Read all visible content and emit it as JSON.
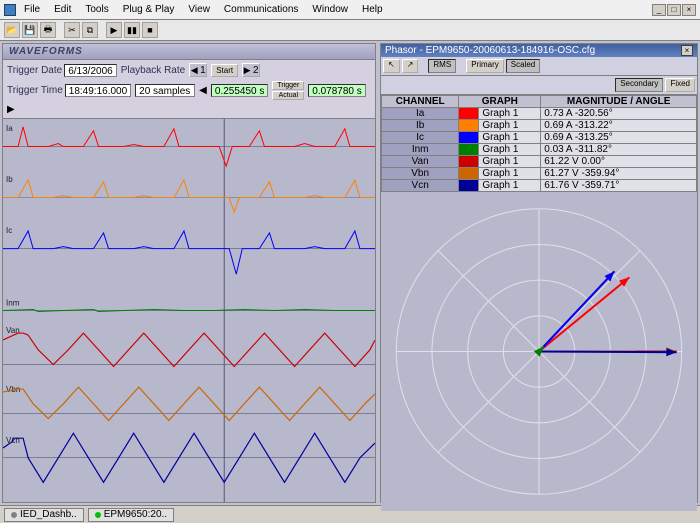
{
  "menu": {
    "items": [
      "File",
      "Edit",
      "Tools",
      "Plug & Play",
      "View",
      "Communications",
      "Window",
      "Help"
    ]
  },
  "waveforms": {
    "title": "WAVEFORMS",
    "trigger_date_label": "Trigger Date",
    "trigger_date": "6/13/2006",
    "trigger_time_label": "Trigger Time",
    "trigger_time": "18:49:16.000",
    "playback_rate_label": "Playback Rate",
    "playback_rate": "20 samples",
    "nav_prev": "1",
    "nav_next": "2",
    "start_btn": "Start",
    "trigger_btn": "Trigger",
    "actual_btn": "Actual",
    "time1": "0.255450 s",
    "time2": "0.078780 s",
    "channels": [
      "Ia",
      "Ib",
      "Ic",
      "Inm",
      "Van",
      "Vbn",
      "Vcn"
    ]
  },
  "phasor": {
    "title": "Phasor - EPM9650-20060613-184916-OSC.cfg",
    "btn_rms": "RMS",
    "btn_primary": "Primary",
    "btn_scaled": "Scaled",
    "btn_secondary": "Secondary",
    "btn_fixed": "Fixed",
    "th_channel": "CHANNEL",
    "th_graph": "GRAPH",
    "th_mag": "MAGNITUDE / ANGLE",
    "rows": [
      {
        "ch": "Ia",
        "color": "#ff0000",
        "graph": "Graph 1",
        "val": "0.73 A -320.56°"
      },
      {
        "ch": "Ib",
        "color": "#ff8000",
        "graph": "Graph 1",
        "val": "0.69 A -313.22°"
      },
      {
        "ch": "Ic",
        "color": "#0000ff",
        "graph": "Graph 1",
        "val": "0.69 A -313.25°"
      },
      {
        "ch": "Inm",
        "color": "#008000",
        "graph": "Graph 1",
        "val": "0.03 A -311.82°"
      },
      {
        "ch": "Van",
        "color": "#cc0000",
        "graph": "Graph 1",
        "val": "61.22 V 0.00°"
      },
      {
        "ch": "Vbn",
        "color": "#cc6600",
        "graph": "Graph 1",
        "val": "61.27 V -359.94°"
      },
      {
        "ch": "Vcn",
        "color": "#000099",
        "graph": "Graph 1",
        "val": "61.76 V -359.71°"
      }
    ]
  },
  "status": {
    "tab1": "IED_Dashb..",
    "tab2": "EPM9650:20.."
  },
  "chart_data": {
    "waveform_traces": [
      {
        "name": "Ia",
        "color": "#ff0000",
        "type": "spiky_current"
      },
      {
        "name": "Ib",
        "color": "#ff8000",
        "type": "spiky_current"
      },
      {
        "name": "Ic",
        "color": "#0000ff",
        "type": "spiky_current"
      },
      {
        "name": "Inm",
        "color": "#008000",
        "type": "flat"
      },
      {
        "name": "Van",
        "color": "#cc0000",
        "type": "sine"
      },
      {
        "name": "Vbn",
        "color": "#cc6600",
        "type": "sine"
      },
      {
        "name": "Vcn",
        "color": "#000099",
        "type": "sine_stepped"
      }
    ],
    "phasor_vectors": [
      {
        "name": "Van",
        "color": "#cc0000",
        "mag": 1.0,
        "angle": 0
      },
      {
        "name": "Vbn",
        "color": "#cc6600",
        "mag": 1.0,
        "angle": -0.06
      },
      {
        "name": "Vcn",
        "color": "#000099",
        "mag": 1.0,
        "angle": -0.29
      },
      {
        "name": "Ia",
        "color": "#ff0000",
        "mag": 0.85,
        "angle": 39.4
      },
      {
        "name": "Ib",
        "color": "#ff8000",
        "mag": 0.8,
        "angle": 46.8
      },
      {
        "name": "Ic",
        "color": "#0000ff",
        "mag": 0.8,
        "angle": 46.75
      },
      {
        "name": "Inm",
        "color": "#008000",
        "mag": 0.05,
        "angle": 48
      }
    ]
  }
}
